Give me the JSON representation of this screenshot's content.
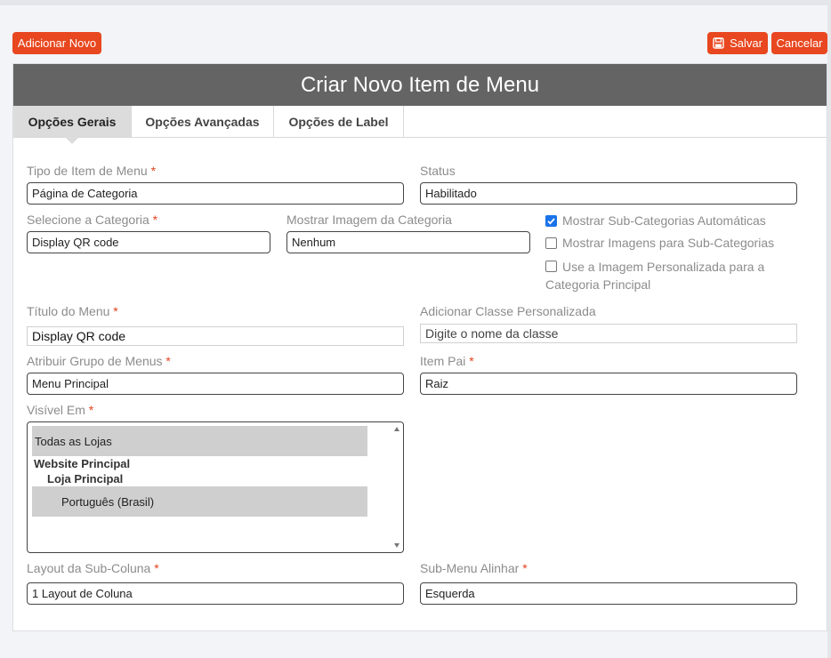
{
  "toolbar": {
    "add_label": "Adicionar Novo",
    "save_label": "Salvar",
    "cancel_label": "Cancelar"
  },
  "panel": {
    "title": "Criar Novo Item de Menu",
    "tabs": [
      {
        "label": "Opções Gerais",
        "active": true
      },
      {
        "label": "Opções Avançadas",
        "active": false
      },
      {
        "label": "Opções de Label",
        "active": false
      }
    ]
  },
  "form": {
    "required_mark": "*",
    "item_type": {
      "label": "Tipo de Item de Menu",
      "value": "Página de Categoria"
    },
    "status": {
      "label": "Status",
      "value": "Habilitado"
    },
    "category": {
      "label": "Selecione a Categoria",
      "value": "Display QR code"
    },
    "category_image": {
      "label": "Mostrar Imagem da Categoria",
      "value": "Nenhum"
    },
    "checkboxes": [
      {
        "label": "Mostrar Sub-Categorias Automáticas",
        "checked": true
      },
      {
        "label": "Mostrar Imagens para Sub-Categorias",
        "checked": false
      },
      {
        "label_line1": "Use a Imagem Personalizada para a",
        "label_line2": "Categoria Principal",
        "checked": false
      }
    ],
    "menu_title": {
      "label": "Título do Menu",
      "value": "Display QR code"
    },
    "custom_class": {
      "label": "Adicionar Classe Personalizada",
      "placeholder": "Digite o nome da classe"
    },
    "menu_group": {
      "label": "Atribuir Grupo de Menus",
      "value": "Menu Principal"
    },
    "parent_item": {
      "label": "Item Pai",
      "value": "Raiz"
    },
    "visible_in": {
      "label": "Visível Em",
      "options": {
        "all_stores": "Todas as Lojas",
        "website": "Website Principal",
        "store": "Loja Principal",
        "store_view": "Português (Brasil)"
      }
    },
    "subcolumn_layout": {
      "label": "Layout da Sub-Coluna",
      "value": "1 Layout de Coluna"
    },
    "submenu_align": {
      "label": "Sub-Menu Alinhar",
      "value": "Esquerda"
    }
  },
  "colors": {
    "accent": "#e8471f",
    "header_bg": "#646464",
    "checkbox_on": "#1a73e8"
  }
}
